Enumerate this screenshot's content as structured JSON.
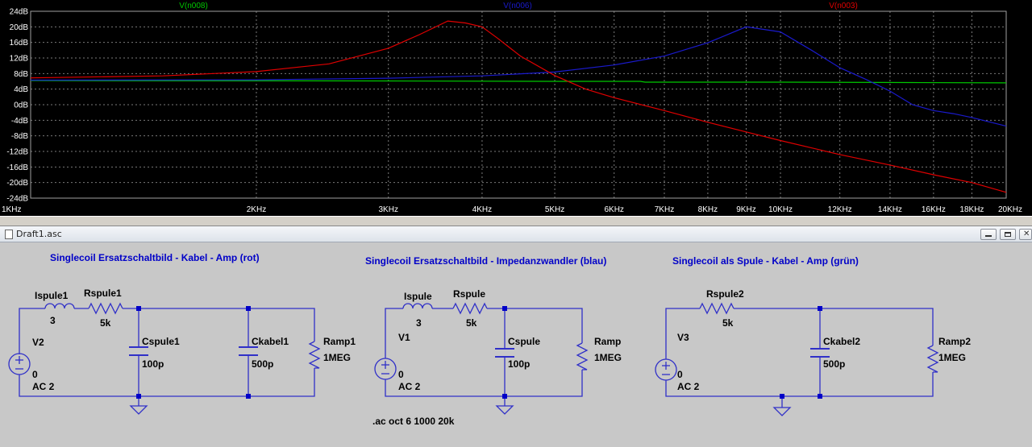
{
  "plot": {
    "traces": [
      {
        "name": "V(n008)",
        "color": "#00c800"
      },
      {
        "name": "V(n006)",
        "color": "#1a1acc"
      },
      {
        "name": "V(n003)",
        "color": "#e00000"
      }
    ],
    "y_ticks": [
      "24dB",
      "20dB",
      "16dB",
      "12dB",
      "8dB",
      "4dB",
      "0dB",
      "-4dB",
      "-8dB",
      "-12dB",
      "-16dB",
      "-20dB",
      "-24dB"
    ],
    "x_ticks": [
      "1KHz",
      "2KHz",
      "3KHz",
      "4KHz",
      "5KHz",
      "6KHz",
      "7KHz",
      "8KHz",
      "9KHz",
      "10KHz",
      "12KHz",
      "14KHz",
      "16KHz",
      "18KHz",
      "20KHz"
    ]
  },
  "chart_data": {
    "type": "line",
    "xscale": "log",
    "x_unit": "Hz",
    "y_unit": "dB",
    "xlim": [
      1000,
      20000
    ],
    "ylim": [
      -24,
      24
    ],
    "grid": true,
    "series": [
      {
        "name": "V(n008)",
        "color": "#00c800",
        "points": [
          [
            1000,
            6.2
          ],
          [
            3000,
            6.1
          ],
          [
            5000,
            6.0
          ],
          [
            6500,
            6.0
          ],
          [
            6600,
            5.8
          ],
          [
            10000,
            5.8
          ],
          [
            15000,
            5.7
          ],
          [
            20000,
            5.6
          ]
        ]
      },
      {
        "name": "V(n006)",
        "color": "#1a1acc",
        "points": [
          [
            1000,
            6.3
          ],
          [
            2000,
            6.4
          ],
          [
            3000,
            6.8
          ],
          [
            4000,
            7.4
          ],
          [
            5000,
            8.4
          ],
          [
            6000,
            10.2
          ],
          [
            7000,
            12.5
          ],
          [
            8000,
            15.9
          ],
          [
            9000,
            20.0
          ],
          [
            10000,
            18.7
          ],
          [
            11000,
            14.0
          ],
          [
            12000,
            9.5
          ],
          [
            13000,
            6.5
          ],
          [
            14000,
            3.5
          ],
          [
            15000,
            0.0
          ],
          [
            16000,
            -1.5
          ],
          [
            17000,
            -2.3
          ],
          [
            18000,
            -3.3
          ],
          [
            20000,
            -5.5
          ]
        ]
      },
      {
        "name": "V(n003)",
        "color": "#e00000",
        "points": [
          [
            1000,
            6.9
          ],
          [
            1500,
            7.4
          ],
          [
            2000,
            8.5
          ],
          [
            2500,
            10.5
          ],
          [
            3000,
            14.5
          ],
          [
            3300,
            18.0
          ],
          [
            3600,
            21.5
          ],
          [
            3800,
            21.0
          ],
          [
            4000,
            20.0
          ],
          [
            4200,
            17.0
          ],
          [
            4500,
            12.5
          ],
          [
            5000,
            7.5
          ],
          [
            5500,
            4.0
          ],
          [
            6000,
            1.8
          ],
          [
            7000,
            -1.5
          ],
          [
            8000,
            -4.5
          ],
          [
            9000,
            -7.0
          ],
          [
            10000,
            -9.2
          ],
          [
            12000,
            -12.8
          ],
          [
            14000,
            -15.5
          ],
          [
            16000,
            -18.0
          ],
          [
            18000,
            -20.0
          ],
          [
            20000,
            -22.5
          ]
        ]
      }
    ]
  },
  "window": {
    "title": "Draft1.asc"
  },
  "schematic": {
    "headings": [
      "Singlecoil Ersatzschaltbild - Kabel - Amp (rot)",
      "Singlecoil Ersatzschaltbild - Impedanzwandler (blau)",
      "Singlecoil als Spule - Kabel - Amp (grün)"
    ],
    "circuit1": {
      "inductor": {
        "name": "Ispule1",
        "value": "3"
      },
      "resistor": {
        "name": "Rspule1",
        "value": "5k"
      },
      "source": {
        "name": "V2",
        "dc": "0",
        "ac": "AC 2"
      },
      "cap1": {
        "name": "Cspule1",
        "value": "100p"
      },
      "cap2": {
        "name": "Ckabel1",
        "value": "500p"
      },
      "load": {
        "name": "Ramp1",
        "value": "1MEG"
      }
    },
    "circuit2": {
      "inductor": {
        "name": "Ispule",
        "value": "3"
      },
      "resistor": {
        "name": "Rspule",
        "value": "5k"
      },
      "source": {
        "name": "V1",
        "dc": "0",
        "ac": "AC 2"
      },
      "cap1": {
        "name": "Cspule",
        "value": "100p"
      },
      "load": {
        "name": "Ramp",
        "value": "1MEG"
      }
    },
    "circuit3": {
      "resistor": {
        "name": "Rspule2",
        "value": "5k"
      },
      "source": {
        "name": "V3",
        "dc": "0",
        "ac": "AC 2"
      },
      "cap2": {
        "name": "Ckabel2",
        "value": "500p"
      },
      "load": {
        "name": "Ramp2",
        "value": "1MEG"
      }
    },
    "directive": ".ac oct 6 1000 20k"
  }
}
